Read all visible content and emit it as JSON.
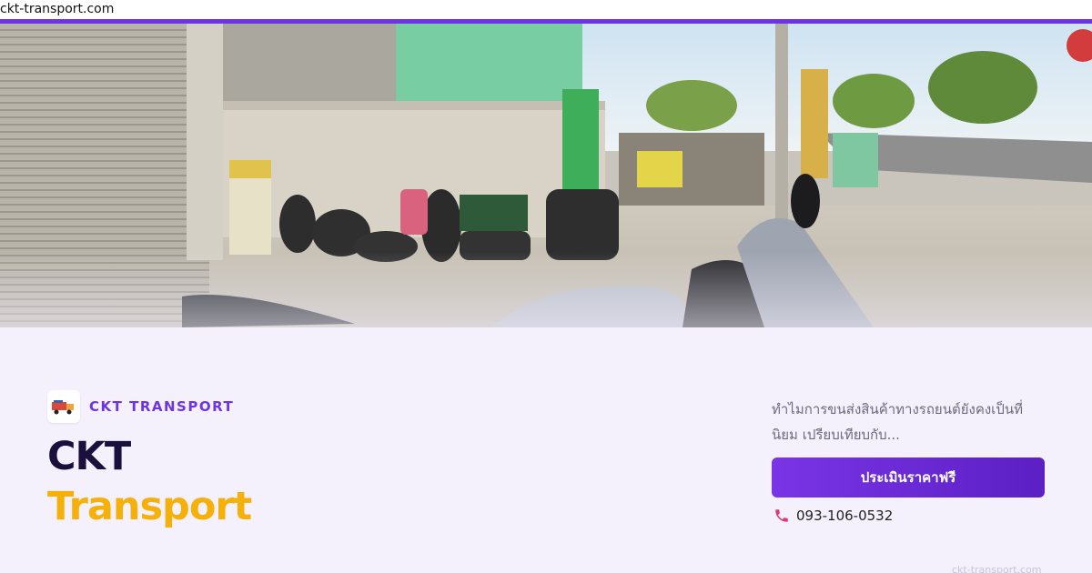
{
  "browser": {
    "url": "ckt-transport.com"
  },
  "hero": {
    "image_icon": "street-photo",
    "colors": {
      "accent_line": "#6d35e0"
    }
  },
  "brand": {
    "logo_icon": "truck-logo-icon",
    "name": "CKT TRANSPORT"
  },
  "title": {
    "line1": "CKT",
    "line2": "Transport"
  },
  "article": {
    "excerpt": "ทำไมการขนส่งสินค้าทางรถยนต์ยังคงเป็นที่นิยม เปรียบเทียบกับ..."
  },
  "cta": {
    "label": "ประเมินราคาฟรี"
  },
  "contact": {
    "phone_icon": "phone-icon",
    "phone": "093-106-0532"
  },
  "footer": {
    "domain": "ckt-transport.com"
  },
  "colors": {
    "brand_purple": "#6d35e0",
    "title_dark": "#1b0f3d",
    "title_yellow": "#f5b10a",
    "background": "#f4f1fd"
  }
}
